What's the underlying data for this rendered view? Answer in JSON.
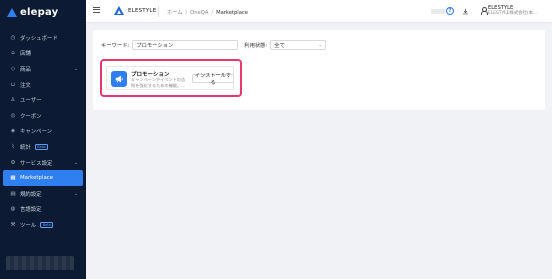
{
  "sidebar": {
    "logo_text": "elepay",
    "items": [
      {
        "label": "ダッシュボード",
        "icon": "clock-icon",
        "chevron": false,
        "badge": ""
      },
      {
        "label": "店舗",
        "icon": "store-icon",
        "chevron": false,
        "badge": ""
      },
      {
        "label": "商品",
        "icon": "tag-icon",
        "chevron": true,
        "badge": ""
      },
      {
        "label": "注文",
        "icon": "cart-icon",
        "chevron": false,
        "badge": ""
      },
      {
        "label": "ユーザー",
        "icon": "user-icon",
        "chevron": false,
        "badge": ""
      },
      {
        "label": "クーポン",
        "icon": "coupon-icon",
        "chevron": false,
        "badge": ""
      },
      {
        "label": "キャンペーン",
        "icon": "campaign-icon",
        "chevron": false,
        "badge": ""
      },
      {
        "label": "統計",
        "icon": "chart-icon",
        "chevron": false,
        "badge": "Beta"
      },
      {
        "label": "サービス設定",
        "icon": "gear-icon",
        "chevron": true,
        "badge": ""
      },
      {
        "label": "Marketplace",
        "icon": "grid-icon",
        "chevron": false,
        "badge": "",
        "active": true
      },
      {
        "label": "規約設定",
        "icon": "document-icon",
        "chevron": true,
        "badge": ""
      },
      {
        "label": "言語設定",
        "icon": "globe-icon",
        "chevron": false,
        "badge": ""
      },
      {
        "label": "ツール",
        "icon": "wrench-icon",
        "chevron": false,
        "badge": "Beta"
      }
    ]
  },
  "header": {
    "app_name": "ELESTYLE",
    "breadcrumb": [
      "ホーム",
      "OneQA",
      "Marketplace"
    ],
    "user_name": "ELESTYLE",
    "user_org": "ELESTYLE株式会社(本..."
  },
  "filters": {
    "keyword_label": "キーワード:",
    "keyword_value": "プロモーション",
    "status_label": "利用状態:",
    "status_value": "全て"
  },
  "app_card": {
    "title": "プロモーション",
    "description": "キャンペーンやイベントの告知を強化するための機能。...",
    "install_label": "インストールする",
    "icon": "megaphone-icon",
    "highlight_color": "#e6386e"
  },
  "colors": {
    "sidebar_bg": "#0c1b33",
    "accent": "#2f7ff0"
  }
}
